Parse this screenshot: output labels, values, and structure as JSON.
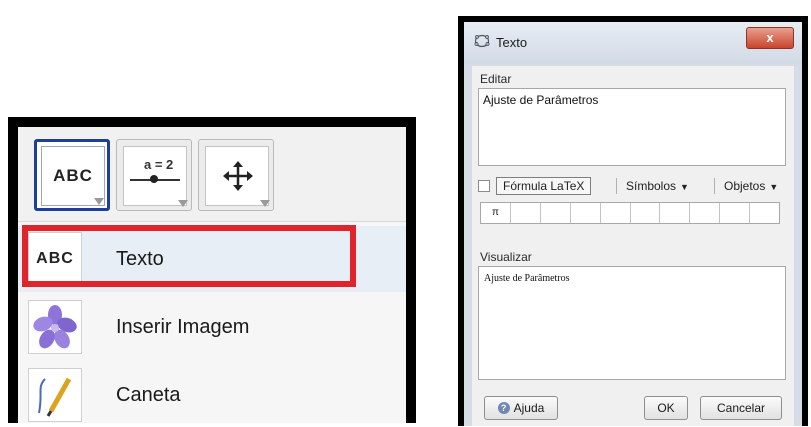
{
  "toolbar": {
    "text_tool_label": "ABC",
    "slider_tool_label": "a = 2",
    "move_tool_icon": "move-arrows-icon"
  },
  "menu": {
    "items": [
      {
        "label": "Texto",
        "icon": "abc-text-icon",
        "icon_text": "ABC"
      },
      {
        "label": "Inserir Imagem",
        "icon": "flower-image-icon"
      },
      {
        "label": "Caneta",
        "icon": "pen-icon"
      }
    ],
    "highlight_color": "#e0242b"
  },
  "dialog": {
    "title": "Texto",
    "close_label": "x",
    "edit_label": "Editar",
    "edit_value": "Ajuste de Parâmetros",
    "latex_label": "Fórmula LaTeX",
    "symbols_label": "Símbolos",
    "objects_label": "Objetos",
    "symbols": [
      "π",
      "",
      "",
      "",
      "",
      "",
      "",
      "",
      "",
      ""
    ],
    "preview_label": "Visualizar",
    "preview_value": "Ajuste de Parâmetros",
    "help_label": "Ajuda",
    "ok_label": "OK",
    "cancel_label": "Cancelar"
  }
}
